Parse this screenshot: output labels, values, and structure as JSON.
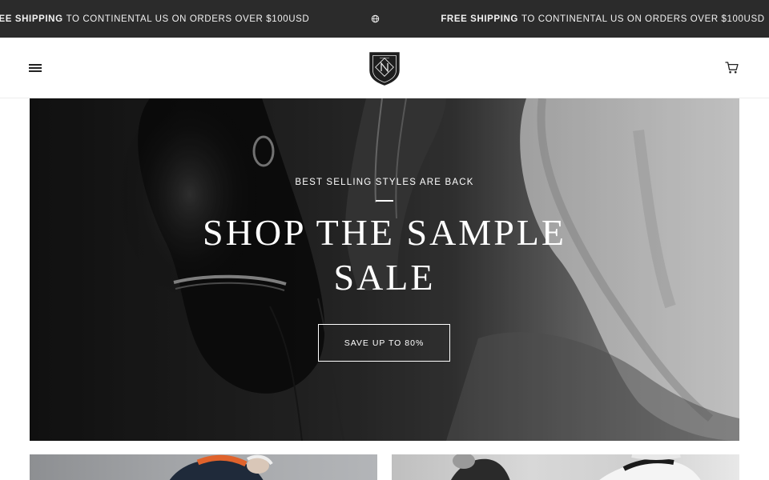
{
  "announcement": {
    "items": [
      {
        "strong": "FREE SHIPPING",
        "rest": "TO CONTINENTAL US ON ORDERS OVER $100USD"
      },
      {
        "strong": "FREE SHIPPING",
        "rest": "TO CONTINENTAL US ON ORDERS OVER $100USD"
      }
    ],
    "icon": "globe-icon"
  },
  "header": {
    "menu_icon": "hamburger-icon",
    "logo_icon": "shield-crest-logo",
    "cart_icon": "shopping-cart-icon"
  },
  "hero": {
    "kicker": "BEST SELLING STYLES ARE BACK",
    "title": "SHOP THE SAMPLE SALE",
    "cta_label": "SAVE UP TO 80%"
  },
  "tiles": [
    {
      "image": "rider-with-orange-collar"
    },
    {
      "image": "riders-in-black-and-white-jackets"
    }
  ],
  "colors": {
    "announcement_bg": "#2b2b2b",
    "announcement_text": "#f2f2f2",
    "header_bg": "#ffffff",
    "hero_text": "#ffffff"
  }
}
